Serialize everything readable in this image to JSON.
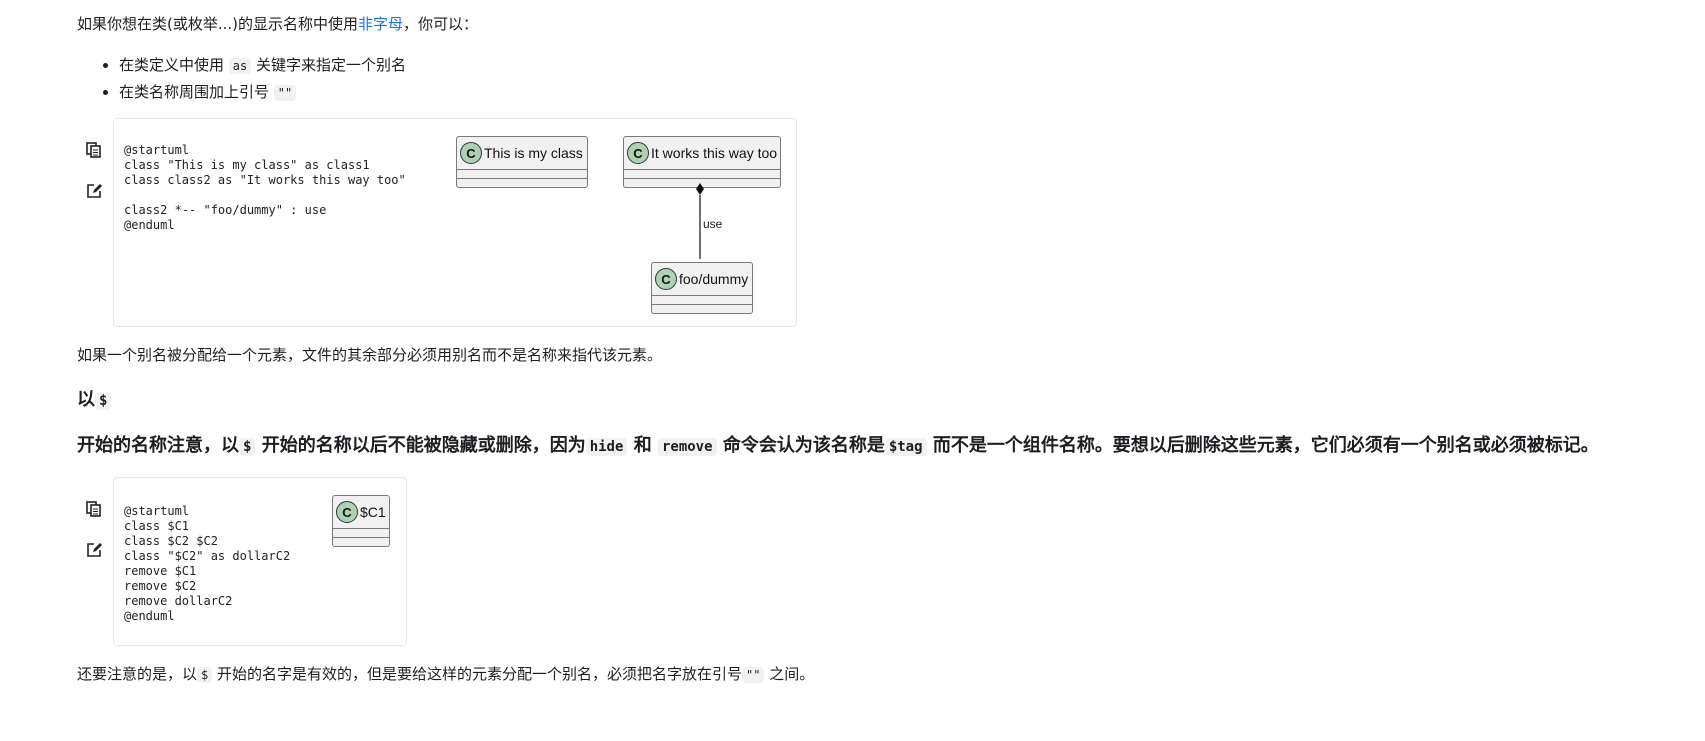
{
  "intro": {
    "before": "如果你想在类(或枚举...)的显示名称中使用",
    "link": "非字母",
    "after": "，你可以："
  },
  "bullets": [
    {
      "before": "在类定义中使用",
      "code": "as",
      "after": " 关键字来指定一个别名"
    },
    {
      "before": "在类名称周围加上引号",
      "code": "\"\"",
      "after": ""
    }
  ],
  "example1": {
    "copy_icon": "copy-icon",
    "edit_icon": "edit-icon",
    "source": "@startuml\nclass \"This is my class\" as class1\nclass class2 as \"It works this way too\"\n\nclass2 *-- \"foo/dummy\" : use\n@enduml",
    "classes": [
      {
        "badge": "C",
        "name": "This is my class"
      },
      {
        "badge": "C",
        "name": "It works this way too"
      },
      {
        "badge": "C",
        "name": "foo/dummy"
      }
    ],
    "relation_label": "use"
  },
  "alias_note": "如果一个别名被分配给一个元素，文件的其余部分必须用别名而不是名称来指代该元素。",
  "heading1": {
    "text": "以",
    "code": "$"
  },
  "heading2": {
    "t1": "开始的名称注意，以",
    "c1": "$",
    "t2": " 开始的名称以后不能被隐藏或删除，因为",
    "c2": "hide",
    "t3": " 和 ",
    "c3": "remove",
    "t4": " 命令会认为该名称是",
    "c4": "$tag",
    "t5": " 而不是一个组件名称。要想以后删除这些元素，它们必须有一个别名或必须被标记。"
  },
  "example2": {
    "copy_icon": "copy-icon",
    "edit_icon": "edit-icon",
    "source": "@startuml\nclass $C1\nclass $C2 $C2\nclass \"$C2\" as dollarC2\nremove $C1\nremove $C2\nremove dollarC2\n@enduml",
    "classes": [
      {
        "badge": "C",
        "name": "$C1"
      }
    ]
  },
  "final_note": {
    "t1": "还要注意的是，以",
    "c1": "$",
    "t2": " 开始的名字是有效的，但是要给这样的元素分配一个别名，必须把名字放在引号",
    "c2": "\"\"",
    "t3": " 之间。"
  }
}
